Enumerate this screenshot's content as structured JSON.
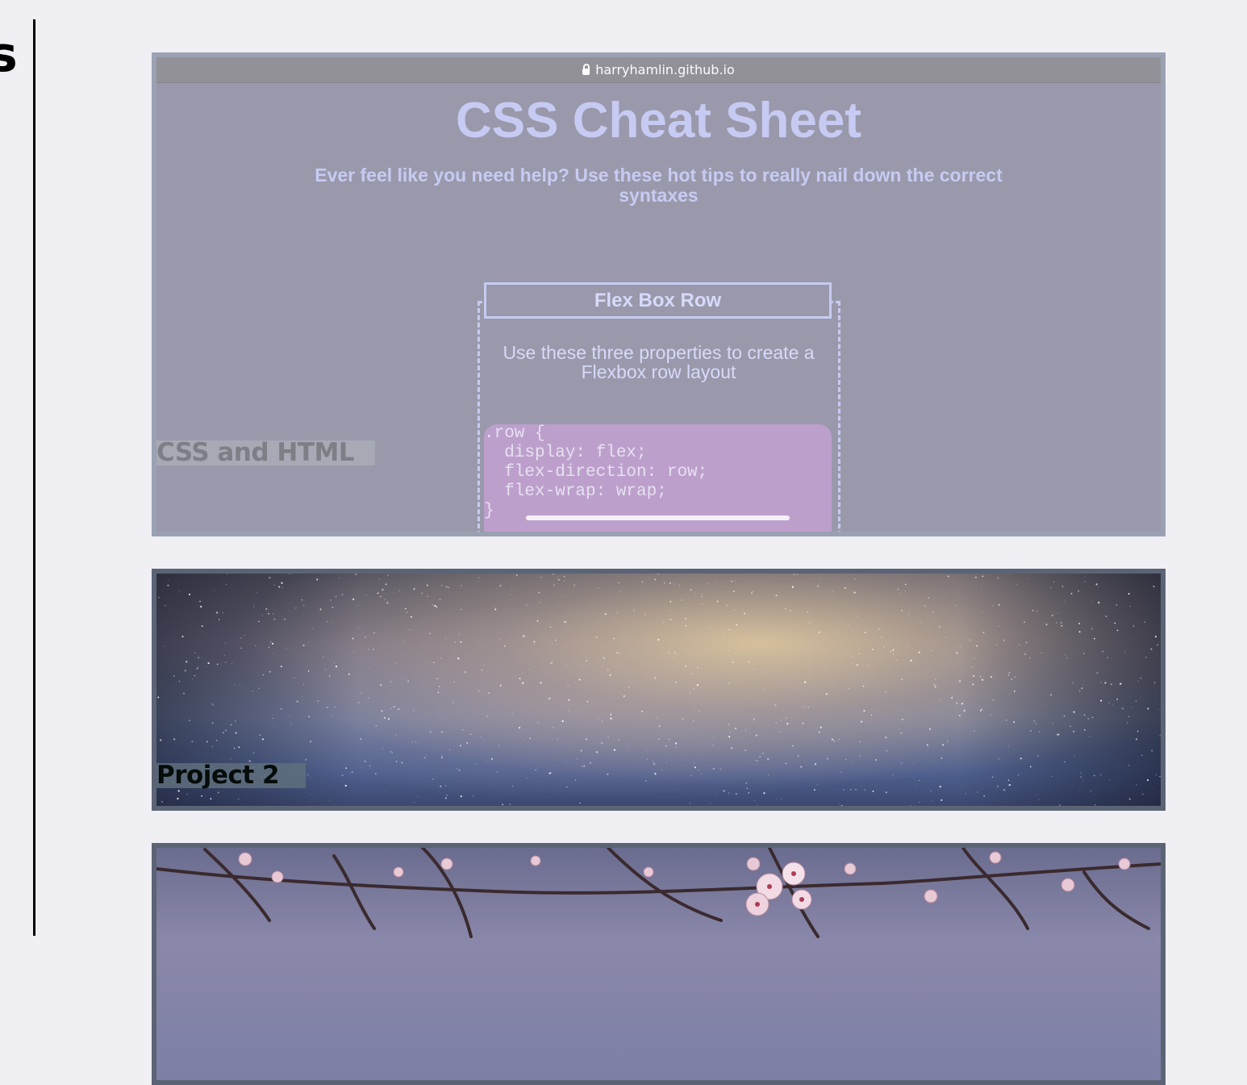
{
  "page": {
    "edge_text": "s"
  },
  "projects": [
    {
      "id": "project-1",
      "label": "CSS and HTML",
      "preview": {
        "url": "harryhamlin.github.io",
        "title": "CSS Cheat Sheet",
        "subtitle": "Ever feel like you need help? Use these hot tips to really nail down the correct syntaxes",
        "flex_card": {
          "title": "Flex Box Row",
          "description": "Use these three properties to create a Flexbox row layout",
          "code": ".row {\n  display: flex;\n  flex-direction: row;\n  flex-wrap: wrap;\n}"
        }
      }
    },
    {
      "id": "project-2",
      "label": "Project 2",
      "image_subject": "night sky with stars"
    },
    {
      "id": "project-3",
      "image_subject": "cherry blossom branches"
    }
  ],
  "colors": {
    "page_background": "#efeff4",
    "card_border": "#5b6475",
    "preview_accent": "#c7cbf3",
    "code_background": "#bd9fcc"
  }
}
